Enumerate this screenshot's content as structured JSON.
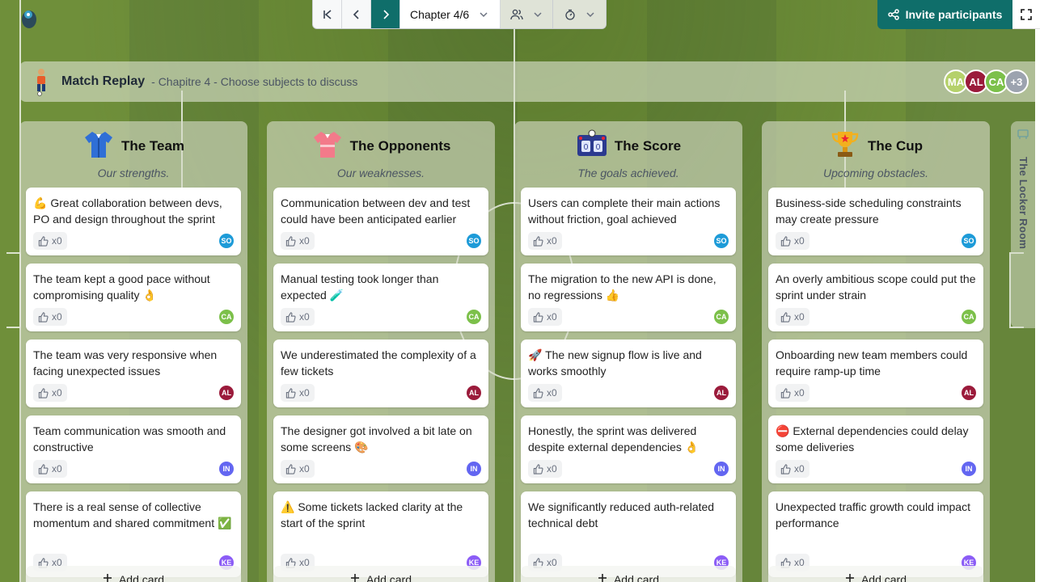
{
  "toolbar": {
    "chapter_label": "Chapter 4/6",
    "invite_label": "Invite participants"
  },
  "header": {
    "title": "Match Replay",
    "subtitle": "- Chapitre 4 - Choose subjects to discuss",
    "participants": [
      {
        "initials": "MA",
        "color": "#b5d16b"
      },
      {
        "initials": "AL",
        "color": "#9b1b3b"
      },
      {
        "initials": "CA",
        "color": "#7cc04a"
      }
    ],
    "more_count": "+3"
  },
  "authors": {
    "SO": "#1d9bd8",
    "CA": "#7cc04a",
    "AL": "#9b1b3b",
    "IN": "#6366f1",
    "KE": "#8b5cf6"
  },
  "columns": [
    {
      "title": "The Team",
      "subtitle": "Our strengths.",
      "icon": "jersey-blue-icon",
      "add_label": "Add card",
      "cards": [
        {
          "text": "💪 Great collaboration between devs, PO and design throughout the sprint",
          "votes": "x0",
          "author": "SO"
        },
        {
          "text": "The team kept a good pace without compromising quality 👌",
          "votes": "x0",
          "author": "CA"
        },
        {
          "text": "The team was very responsive when facing unexpected issues",
          "votes": "x0",
          "author": "AL"
        },
        {
          "text": "Team communication was smooth and constructive",
          "votes": "x0",
          "author": "IN"
        },
        {
          "text": "There is a real sense of collective momentum and shared commitment ✅",
          "votes": "x0",
          "author": "KE"
        }
      ]
    },
    {
      "title": "The Opponents",
      "subtitle": "Our weaknesses.",
      "icon": "jersey-red-icon",
      "add_label": "Add card",
      "cards": [
        {
          "text": "Communication between dev and test could have been anticipated earlier",
          "votes": "x0",
          "author": "SO"
        },
        {
          "text": "Manual testing took longer than expected 🧪",
          "votes": "x0",
          "author": "CA"
        },
        {
          "text": "We underestimated the complexity of a few tickets",
          "votes": "x0",
          "author": "AL"
        },
        {
          "text": "The designer got involved a bit late on some screens 🎨",
          "votes": "x0",
          "author": "IN"
        },
        {
          "text": "⚠️ Some tickets lacked clarity at the start of the sprint",
          "votes": "x0",
          "author": "KE"
        }
      ]
    },
    {
      "title": "The Score",
      "subtitle": "The goals achieved.",
      "icon": "scoreboard-icon",
      "add_label": "Add card",
      "cards": [
        {
          "text": "Users can complete their main actions without friction, goal achieved",
          "votes": "x0",
          "author": "SO"
        },
        {
          "text": "The migration to the new API is done, no regressions 👍",
          "votes": "x0",
          "author": "CA"
        },
        {
          "text": "🚀 The new signup flow is live and works smoothly",
          "votes": "x0",
          "author": "AL"
        },
        {
          "text": "Honestly, the sprint was delivered despite external dependencies 👌",
          "votes": "x0",
          "author": "IN"
        },
        {
          "text": "We significantly reduced auth-related technical debt",
          "votes": "x0",
          "author": "KE"
        }
      ]
    },
    {
      "title": "The Cup",
      "subtitle": "Upcoming obstacles.",
      "icon": "trophy-icon",
      "add_label": "Add card",
      "cards": [
        {
          "text": "Business-side scheduling constraints may create pressure",
          "votes": "x0",
          "author": "SO"
        },
        {
          "text": "An overly ambitious scope could put the sprint under strain",
          "votes": "x0",
          "author": "CA"
        },
        {
          "text": "Onboarding new team members could require ramp-up time",
          "votes": "x0",
          "author": "AL"
        },
        {
          "text": "⛔ External dependencies could delay some deliveries",
          "votes": "x0",
          "author": "IN"
        },
        {
          "text": "Unexpected traffic growth could impact performance",
          "votes": "x0",
          "author": "KE"
        }
      ]
    }
  ],
  "locker_room": {
    "label": "The Locker Room",
    "icon": "locker-room-icon"
  }
}
